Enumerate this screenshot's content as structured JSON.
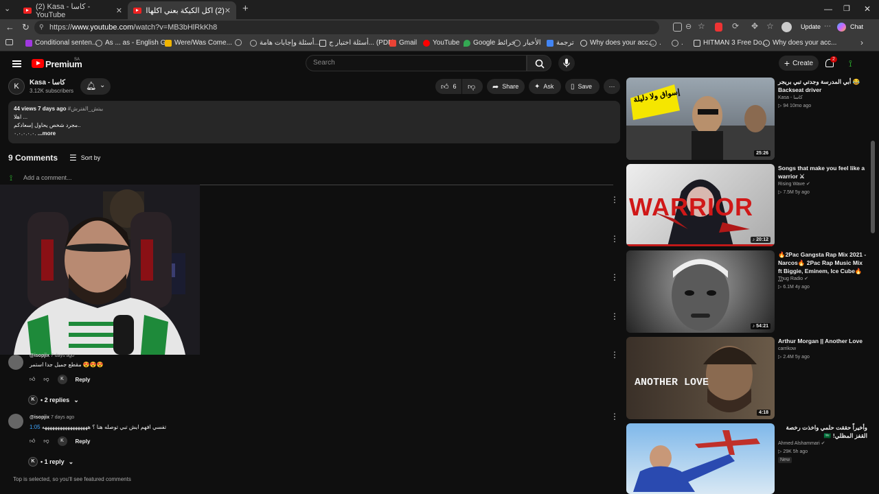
{
  "browser": {
    "tabs": [
      {
        "label": "(2) Kasa - كاسا - YouTube",
        "active": false
      },
      {
        "label": "(2) اكل الكيكة بعني اكلهاااا 🥰 - Tube",
        "active": true
      }
    ],
    "url_prefix": "https://",
    "url_domain": "www.youtube.com",
    "url_path": "/watch?v=MB3bHlRkKh8",
    "update_label": "Update",
    "chat_label": "Chat",
    "bookmarks": [
      {
        "label": "Conditional senten...",
        "color": "#a038e0"
      },
      {
        "label": "As ... as - English G...",
        "color": "#888888"
      },
      {
        "label": "Were/Was Come...",
        "color": "#f0b400"
      },
      {
        "label": "",
        "color": "#888888"
      },
      {
        "label": "أسئلة وإجابات هامة...",
        "color": "#888888"
      },
      {
        "label": "أسئلة اختبار ج... (PDF)",
        "color": "#dddddd"
      },
      {
        "label": "Gmail",
        "color": "#ea4335"
      },
      {
        "label": "YouTube",
        "color": "#ff0000"
      },
      {
        "label": "Google خرائط",
        "color": "#34a853"
      },
      {
        "label": "الأخبار",
        "color": "#888888"
      },
      {
        "label": "ترجمة",
        "color": "#4285f4"
      },
      {
        "label": "Why does your acc...",
        "color": "#dddddd"
      },
      {
        "label": ".",
        "color": "#888888"
      },
      {
        "label": ".",
        "color": "#888888"
      },
      {
        "label": "HITMAN 3 Free Do...",
        "color": "#dddddd"
      },
      {
        "label": "Why does your acc...",
        "color": "#dddddd"
      }
    ]
  },
  "youtube": {
    "brand": "Premium",
    "region": "SA",
    "search_placeholder": "Search",
    "create_label": "Create",
    "notifications": "2"
  },
  "channel": {
    "name": "Kasa - كاسا",
    "subscribers": "3.12K subscribers",
    "likes": "6",
    "share_label": "Share",
    "ask_label": "Ask",
    "save_label": "Save"
  },
  "description": {
    "stats": "44 views  7 days ago",
    "hashtag": "#بيتش_الفترش",
    "line1": "اهلا ...",
    "line2": "مجرد شخص يحاول إسعادكم..",
    "line3": "٠.٠.٠.٠.٠.",
    "more": "...more"
  },
  "comments": {
    "count": "9 Comments",
    "sort_label": "Sort by",
    "add_placeholder": "Add a comment...",
    "items": [
      {
        "handle": "@isopjix",
        "time": "7 days ago",
        "text": "مقطع جميل جدا استمر 😍😍😍",
        "reply_label": "Reply",
        "replies_label": "• 2 replies"
      },
      {
        "handle": "@isopjix",
        "time": "7 days ago",
        "timestamp": "1:05",
        "text": "تفسي افهم ايش تبي توصله هنا ؟ ههههههههههههههههههه",
        "reply_label": "Reply",
        "replies_label": "• 1 reply"
      }
    ],
    "footnote": "Top is selected, so you'll see featured comments"
  },
  "sidebar": [
    {
      "title": "أبي المدرسة وجدتي تبي بريجر 😂 Backseat driver",
      "channel": "Kasa - كاسا",
      "meta": "94  10mo ago",
      "duration": "25:26",
      "thumb_text": "إسواق ولا دليلة"
    },
    {
      "title": "Songs that make you feel like a warrior ⚔",
      "channel": "Rising Wave",
      "meta": "7.5M  5y ago",
      "duration": "20:12",
      "thumb_text": "WARRIOR"
    },
    {
      "title": "🔥2Pac Gangsta Rap Mix 2021 - Narcos🔥 2Pac Rap Music Mix ft Biggie, Eminem, Ice Cube🔥 ...",
      "channel": "Thug Radio",
      "meta": "6.1M  4y ago",
      "duration": "54:21",
      "thumb_text": ""
    },
    {
      "title": "Arthur Morgan || Another Love",
      "channel": "carrikow",
      "meta": "2.4M  5y ago",
      "duration": "4:18",
      "thumb_text": "ANOTHER LOVE"
    },
    {
      "title": "وأخيراً حققت حلمي واخذت رخصة القفز المظلي! 🇸🇦",
      "channel": "Ahmed Alshammari",
      "meta": "29K  5h ago",
      "badge": "New",
      "duration": "",
      "thumb_text": ""
    }
  ]
}
